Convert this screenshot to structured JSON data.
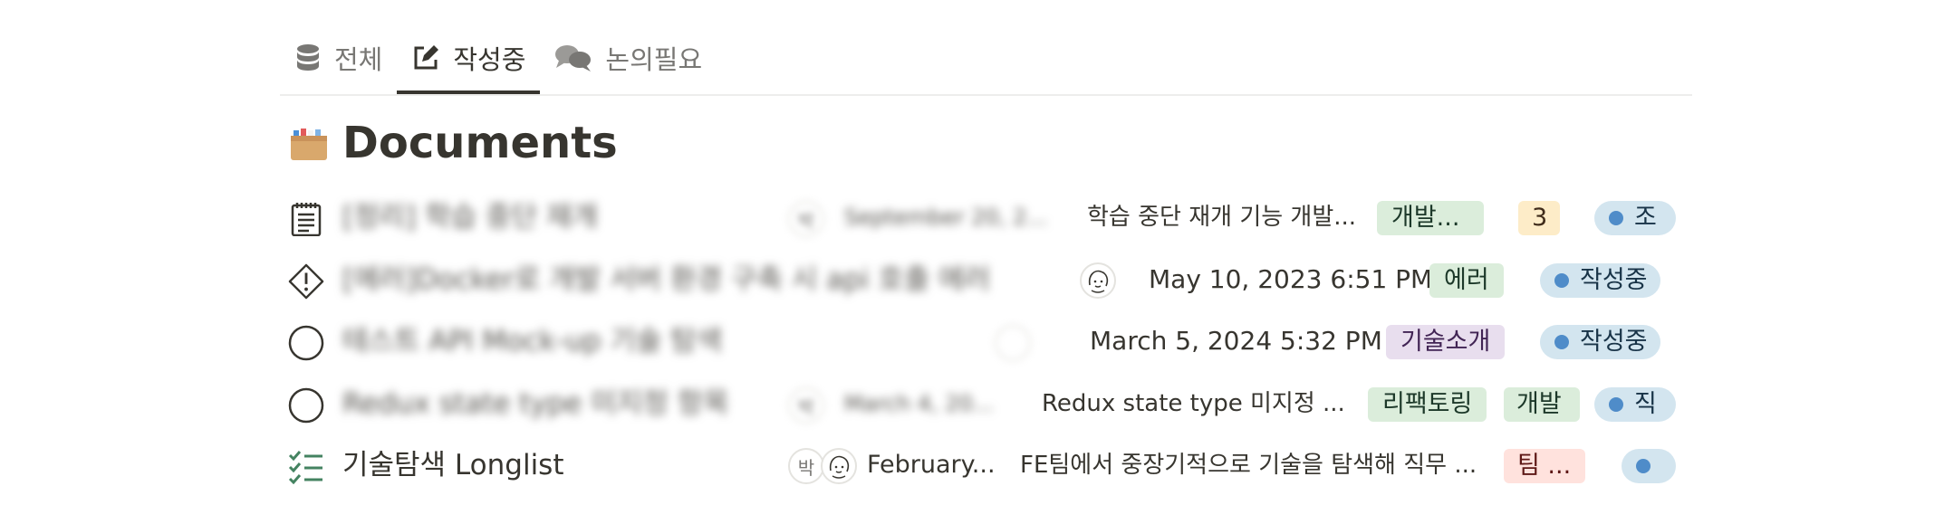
{
  "tabs": [
    {
      "label": "전체",
      "icon": "database-icon",
      "active": false
    },
    {
      "label": "작성중",
      "icon": "edit-icon",
      "active": true
    },
    {
      "label": "논의필요",
      "icon": "chat-icon",
      "active": false
    }
  ],
  "page": {
    "title": "Documents",
    "icon": "file-cabinet-icon"
  },
  "rows": [
    {
      "icon": "notepad-icon",
      "name": "[정리] 학습 중단 재개",
      "date": "September 20, 2...",
      "summary": "학습 중단 재개 기능 개발...",
      "tags": [
        "개발...",
        "3"
      ],
      "status": "조"
    },
    {
      "icon": "warning-diamond-icon",
      "name": "[에러]Docker로 개발 서버 환경 구축 시 api 호출 에러",
      "date": "May 10, 2023 6:51 PM",
      "tags": [
        "에러"
      ],
      "status": "작성중"
    },
    {
      "icon": "circle-icon",
      "name": "테스트 API Mock-up 기술 탐색",
      "date": "March 5, 2024 5:32 PM",
      "tags": [
        "기술소개"
      ],
      "status": "작성중"
    },
    {
      "icon": "circle-icon",
      "name": "Redux state type 미지정 항목",
      "date": "March 4, 20...",
      "summary": "Redux state type 미지정 ...",
      "tags": [
        "리팩토링",
        "개발"
      ],
      "status": "직"
    },
    {
      "icon": "checklist-icon",
      "name": "기술탐색 Longlist",
      "avatar_text": "박",
      "date": "February...",
      "summary": "FE팀에서 중장기적으로 기술을 탐색해 직무 ...",
      "tags": [
        "팀 ..."
      ],
      "status": ""
    }
  ],
  "colors": {
    "green_tag": "#dbeddb",
    "yellow_tag": "#fdecc8",
    "purple_tag": "#e8deee",
    "red_tag": "#ffe2dd",
    "status_bg": "#d3e5ef",
    "status_dot": "#4f8cc9"
  }
}
